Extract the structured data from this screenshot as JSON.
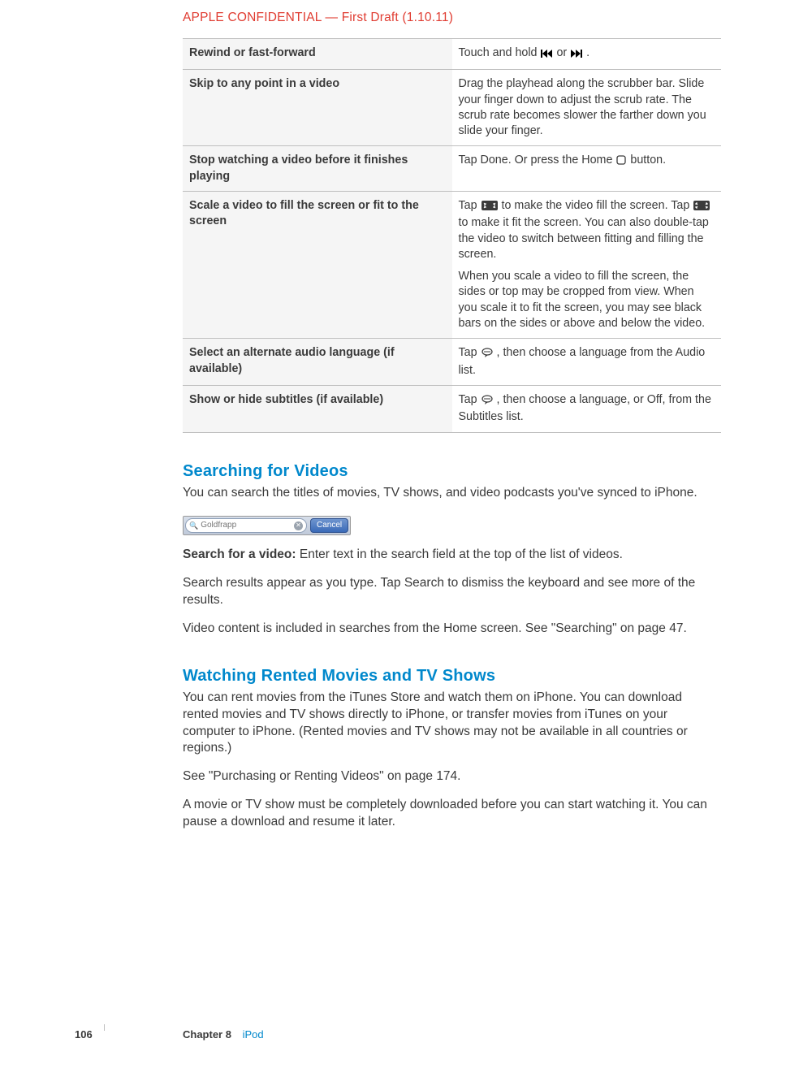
{
  "header": {
    "confidential": "APPLE CONFIDENTIAL  —  First Draft (1.10.11)"
  },
  "table": {
    "r0": {
      "action": "Rewind or fast-forward",
      "desc_pre": "Touch and hold ",
      "or": " or ",
      "desc_post": "."
    },
    "r1": {
      "action": "Skip to any point in a video",
      "desc": "Drag the playhead along the scrubber bar. Slide your finger down to adjust the scrub rate. The scrub rate becomes slower the farther down you slide your finger."
    },
    "r2": {
      "action": "Stop watching a video before it finishes playing",
      "desc_pre": "Tap Done. Or press the Home ",
      "desc_post": " button."
    },
    "r3": {
      "action": "Scale a video to fill the screen or fit to the screen",
      "p1_a": "Tap ",
      "p1_b": " to make the video fill the screen. Tap ",
      "p1_c": " to make it fit the screen. You can also double-tap the video to switch between fitting and filling the screen.",
      "p2": "When you scale a video to fill the screen, the sides or top may be cropped from view. When you scale it to fit the screen, you may see black bars on the sides or above and below the video."
    },
    "r4": {
      "action": "Select an alternate audio language (if available)",
      "desc_pre": "Tap ",
      "desc_post": ", then choose a language from the Audio list."
    },
    "r5": {
      "action": "Show or hide subtitles (if available)",
      "desc_pre": "Tap ",
      "desc_post": ", then choose a language, or Off, from the Subtitles list."
    }
  },
  "sections": {
    "search_h": "Searching for Videos",
    "search_p1": "You can search the titles of movies, TV shows, and video podcasts you've synced to iPhone.",
    "search_lead": "Search for a video:  ",
    "search_lead_rest": "Enter text in the search field at the top of the list of videos.",
    "search_p2": "Search results appear as you type. Tap Search to dismiss the keyboard and see more of the results.",
    "search_p3": "Video content is included in searches from the Home screen. See \"Searching\" on page 47.",
    "rent_h": "Watching Rented Movies and TV Shows",
    "rent_p1": "You can rent movies from the iTunes Store and watch them on iPhone. You can download rented movies and TV shows directly to iPhone, or transfer movies from iTunes on your computer to iPhone. (Rented movies and TV shows may not be available in all countries or regions.)",
    "rent_p2": "See \"Purchasing or Renting Videos\" on page 174.",
    "rent_p3": "A movie or TV show must be completely downloaded before you can start watching it. You can pause a download and resume it later."
  },
  "mock": {
    "search_text": "Goldfrapp",
    "cancel": "Cancel"
  },
  "footer": {
    "page": "106",
    "chapter": "Chapter 8",
    "title": "iPod"
  }
}
